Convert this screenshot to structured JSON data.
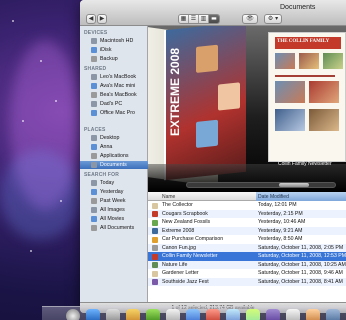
{
  "window": {
    "title": "Documents"
  },
  "toolbar": {
    "back_label": "◀",
    "forward_label": "▶",
    "view_modes": [
      "▦",
      "☰",
      "▥",
      "▬"
    ],
    "eye_label": "👁",
    "action_label": "⚙ ▾"
  },
  "sidebar": {
    "sections": [
      {
        "heading": "DEVICES",
        "items": [
          "Macintosh HD",
          "iDisk",
          "Backup"
        ]
      },
      {
        "heading": "SHARED",
        "items": [
          "Leo's MacBook",
          "Ava's Mac mini",
          "Bea's MacBook",
          "Dad's PC",
          "Office Mac Pro"
        ]
      },
      {
        "heading": "PLACES",
        "items": [
          "Desktop",
          "Anna",
          "Applications",
          "Documents"
        ]
      },
      {
        "heading": "SEARCH FOR",
        "items": [
          "Today",
          "Yesterday",
          "Past Week",
          "All Images",
          "All Movies",
          "All Documents"
        ]
      }
    ],
    "selected": "Documents"
  },
  "coverflow": {
    "magazine_title": "EXTREME 2008",
    "newsletter_title": "THE COLLIN FAMILY",
    "caption": "Collin Family Newsletter"
  },
  "list": {
    "col_name": "Name",
    "col_date": "Date Modified",
    "rows": [
      {
        "name": "The Collector",
        "date": "Today, 12:01 PM"
      },
      {
        "name": "Cougars Scrapbook",
        "date": "Yesterday, 2:15 PM"
      },
      {
        "name": "New Zealand Fossils",
        "date": "Yesterday, 10:46 AM"
      },
      {
        "name": "Extreme 2008",
        "date": "Yesterday, 9:21 AM"
      },
      {
        "name": "Car Purchase Comparison",
        "date": "Yesterday, 8:50 AM"
      },
      {
        "name": "Canon Fun.jpg",
        "date": "Saturday, October 11, 2008, 2:05 PM"
      },
      {
        "name": "Collin Family Newsletter",
        "date": "Saturday, October 11, 2008, 12:53 PM"
      },
      {
        "name": "Nature Life",
        "date": "Saturday, October 11, 2008, 10:25 AM"
      },
      {
        "name": "Gardener Letter",
        "date": "Saturday, October 11, 2008, 9:46 AM"
      },
      {
        "name": "Southside Jazz Fest",
        "date": "Saturday, October 11, 2008, 8:41 AM"
      }
    ],
    "selected_index": 6
  },
  "status": {
    "text": "1 of 12 selected, 213.74 GB available"
  }
}
